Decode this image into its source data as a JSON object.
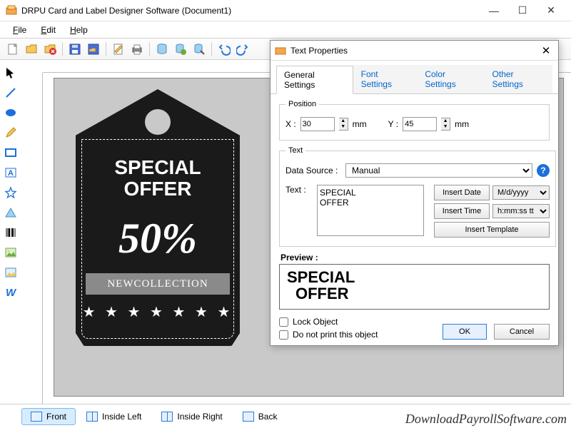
{
  "window": {
    "title": "DRPU Card and Label Designer Software (Document1)"
  },
  "menu": {
    "file": "File",
    "edit": "Edit",
    "help": "Help"
  },
  "pages": {
    "front": "Front",
    "inside_left": "Inside Left",
    "inside_right": "Inside Right",
    "back": "Back"
  },
  "tag": {
    "line1": "SPECIAL",
    "line2": "OFFER",
    "percent": "50%",
    "band": "NEWCOLLECTION",
    "stars": "★ ★ ★ ★ ★ ★ ★"
  },
  "dialog": {
    "title": "Text Properties",
    "tabs": {
      "general": "General Settings",
      "font": "Font Settings",
      "color": "Color Settings",
      "other": "Other Settings"
    },
    "position": {
      "legend": "Position",
      "x_label": "X :",
      "x_value": "30",
      "y_label": "Y :",
      "y_value": "45",
      "unit": "mm"
    },
    "text": {
      "legend": "Text",
      "ds_label": "Data Source :",
      "ds_value": "Manual",
      "text_label": "Text :",
      "text_value": "SPECIAL\nOFFER",
      "insert_date": "Insert Date",
      "date_fmt": "M/d/yyyy",
      "insert_time": "Insert Time",
      "time_fmt": "h:mm:ss tt",
      "insert_template": "Insert Template"
    },
    "preview": {
      "label": "Preview :",
      "line1": "SPECIAL",
      "line2": "OFFER"
    },
    "checks": {
      "lock": "Lock Object",
      "noprint": "Do not print this object"
    },
    "ok": "OK",
    "cancel": "Cancel"
  },
  "watermark": "DownloadPayrollSoftware.com"
}
